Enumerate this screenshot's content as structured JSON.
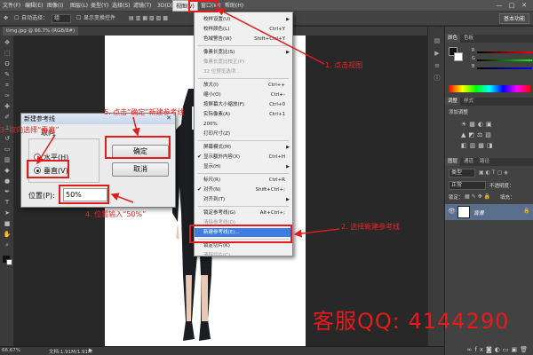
{
  "app": {
    "menus": [
      "文件(F)",
      "编辑(E)",
      "图像(I)",
      "图层(L)",
      "类型(Y)",
      "选择(S)",
      "滤镜(T)",
      "3D(D)",
      "视图(V)",
      "窗口(W)",
      "帮助(H)"
    ],
    "window_controls": [
      "—",
      "□",
      "✕"
    ]
  },
  "options_bar": {
    "auto_select_label": "自动选择：",
    "auto_select_value": "组",
    "show_transform_label": "显示变换控件",
    "workspace": "基本功能"
  },
  "document": {
    "tab_label": "timg.jpg @ 66.7% (RGB/8#)"
  },
  "status": {
    "zoom": "66.67%",
    "doc_info": "文档:1.91M/1.91M"
  },
  "view_menu": {
    "items": [
      {
        "label": "校样设置(U)",
        "shortcut": "",
        "submenu": true,
        "state": "normal"
      },
      {
        "label": "校样颜色(L)",
        "shortcut": "Ctrl+Y",
        "submenu": false,
        "state": "normal"
      },
      {
        "label": "色域警告(W)",
        "shortcut": "Shift+Ctrl+Y",
        "submenu": false,
        "state": "normal"
      },
      {
        "label": "像素长宽比(S)",
        "shortcut": "",
        "submenu": true,
        "state": "normal"
      },
      {
        "label": "像素长宽比校正(P)",
        "shortcut": "",
        "submenu": false,
        "state": "disabled"
      },
      {
        "label": "32 位预览选项...",
        "shortcut": "",
        "submenu": false,
        "state": "disabled"
      },
      {
        "label": "放大(I)",
        "shortcut": "Ctrl++",
        "submenu": false,
        "state": "normal"
      },
      {
        "label": "缩小(O)",
        "shortcut": "Ctrl+-",
        "submenu": false,
        "state": "normal"
      },
      {
        "label": "按屏幕大小缩放(F)",
        "shortcut": "Ctrl+0",
        "submenu": false,
        "state": "normal"
      },
      {
        "label": "实际像素(A)",
        "shortcut": "Ctrl+1",
        "submenu": false,
        "state": "normal"
      },
      {
        "label": "200%",
        "shortcut": "",
        "submenu": false,
        "state": "normal"
      },
      {
        "label": "打印尺寸(Z)",
        "shortcut": "",
        "submenu": false,
        "state": "normal"
      },
      {
        "label": "屏幕模式(M)",
        "shortcut": "",
        "submenu": true,
        "state": "normal"
      },
      {
        "label": "显示额外内容(X)",
        "shortcut": "Ctrl+H",
        "submenu": false,
        "state": "checked"
      },
      {
        "label": "显示(H)",
        "shortcut": "",
        "submenu": true,
        "state": "normal"
      },
      {
        "label": "标尺(R)",
        "shortcut": "Ctrl+R",
        "submenu": false,
        "state": "normal"
      },
      {
        "label": "对齐(N)",
        "shortcut": "Shift+Ctrl+;",
        "submenu": false,
        "state": "checked"
      },
      {
        "label": "对齐到(T)",
        "shortcut": "",
        "submenu": true,
        "state": "normal"
      },
      {
        "label": "锁定参考线(G)",
        "shortcut": "Alt+Ctrl+;",
        "submenu": false,
        "state": "normal"
      },
      {
        "label": "清除参考线(D)",
        "shortcut": "",
        "submenu": false,
        "state": "disabled"
      },
      {
        "label": "新建参考线(E)...",
        "shortcut": "",
        "submenu": false,
        "state": "highlighted"
      },
      {
        "label": "锁定切片(K)",
        "shortcut": "",
        "submenu": false,
        "state": "normal"
      },
      {
        "label": "清除切片(C)",
        "shortcut": "",
        "submenu": false,
        "state": "disabled"
      }
    ]
  },
  "dialog": {
    "title": "新建参考线",
    "close": "✕",
    "orientation_label": "取向",
    "horizontal": "水平(H)",
    "vertical": "垂直(V)",
    "position_label": "位置(P):",
    "position_value": "50%",
    "ok": "确定",
    "cancel": "取消"
  },
  "panels": {
    "color_tabs": [
      "颜色",
      "色板"
    ],
    "adjust_tabs": [
      "调整",
      "样式"
    ],
    "adjust_heading": "添加调整",
    "layer_tabs": [
      "图层",
      "通道",
      "路径"
    ],
    "kind": "类型",
    "blend_mode": "正常",
    "opacity_label": "不透明度：",
    "lock_label": "锁定：",
    "fill_label": "填充：",
    "layer_name": "背景"
  },
  "annotations": {
    "step1": "1. 点击视图",
    "step2": "2. 选择新建参考线",
    "step3": "3. 取向选择“垂直”",
    "step4": "4. 位置输入“50%”",
    "step5": "5. 点击“确定”新建参考线",
    "service": "客服QQ: 4144290",
    "annotation_color": "#e01d1d"
  }
}
